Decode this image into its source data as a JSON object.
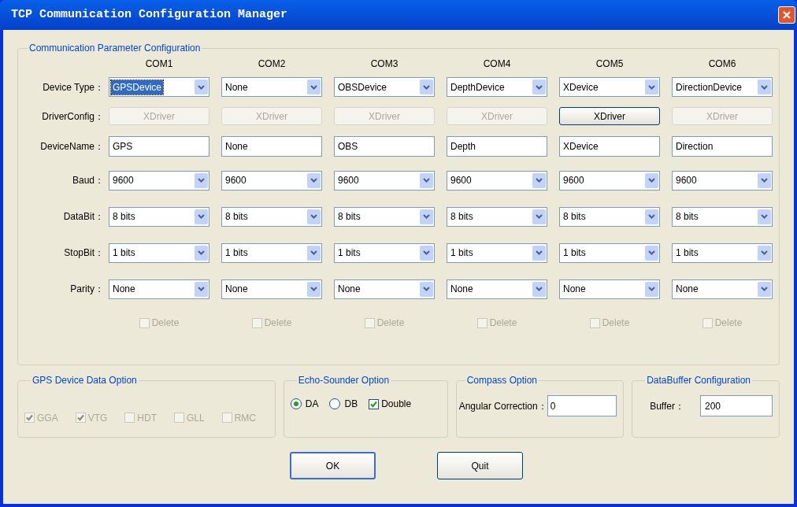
{
  "window": {
    "title": "TCP Communication Configuration Manager"
  },
  "config": {
    "legend": "Communication Parameter Configuration",
    "row_labels": [
      "Device Type：",
      "DriverConfig：",
      "DeviceName：",
      "Baud：",
      "DataBit：",
      "StopBit：",
      "Parity："
    ],
    "ports": [
      {
        "name": "COM1",
        "device_type": {
          "value": "GPSDevice",
          "focused": true
        },
        "driver": {
          "label": "XDriver",
          "disabled": true
        },
        "device_name": "GPS",
        "baud": "9600",
        "data_bit": "8 bits",
        "stop_bit": "1 bits",
        "parity": "None",
        "delete": {
          "label": "Delete",
          "checked": false,
          "disabled": true
        }
      },
      {
        "name": "COM2",
        "device_type": {
          "value": "None",
          "focused": false
        },
        "driver": {
          "label": "XDriver",
          "disabled": true
        },
        "device_name": "None",
        "baud": "9600",
        "data_bit": "8 bits",
        "stop_bit": "1 bits",
        "parity": "None",
        "delete": {
          "label": "Delete",
          "checked": false,
          "disabled": true
        }
      },
      {
        "name": "COM3",
        "device_type": {
          "value": "OBSDevice",
          "focused": false
        },
        "driver": {
          "label": "XDriver",
          "disabled": true
        },
        "device_name": "OBS",
        "baud": "9600",
        "data_bit": "8 bits",
        "stop_bit": "1 bits",
        "parity": "None",
        "delete": {
          "label": "Delete",
          "checked": false,
          "disabled": true
        }
      },
      {
        "name": "COM4",
        "device_type": {
          "value": "DepthDevice",
          "focused": false
        },
        "driver": {
          "label": "XDriver",
          "disabled": true
        },
        "device_name": "Depth",
        "baud": "9600",
        "data_bit": "8 bits",
        "stop_bit": "1 bits",
        "parity": "None",
        "delete": {
          "label": "Delete",
          "checked": false,
          "disabled": true
        }
      },
      {
        "name": "COM5",
        "device_type": {
          "value": "XDevice",
          "focused": false
        },
        "driver": {
          "label": "XDriver",
          "disabled": false
        },
        "device_name": "XDevice",
        "baud": "9600",
        "data_bit": "8 bits",
        "stop_bit": "1 bits",
        "parity": "None",
        "delete": {
          "label": "Delete",
          "checked": false,
          "disabled": true
        }
      },
      {
        "name": "COM6",
        "device_type": {
          "value": "DirectionDevice",
          "focused": false
        },
        "driver": {
          "label": "XDriver",
          "disabled": true
        },
        "device_name": "Direction",
        "baud": "9600",
        "data_bit": "8 bits",
        "stop_bit": "1 bits",
        "parity": "None",
        "delete": {
          "label": "Delete",
          "checked": false,
          "disabled": true
        }
      }
    ]
  },
  "gps_option": {
    "legend": "GPS Device Data Option",
    "items": [
      {
        "label": "GGA",
        "checked": true,
        "disabled": true
      },
      {
        "label": "VTG",
        "checked": true,
        "disabled": true
      },
      {
        "label": "HDT",
        "checked": false,
        "disabled": true
      },
      {
        "label": "GLL",
        "checked": false,
        "disabled": true
      },
      {
        "label": "RMC",
        "checked": false,
        "disabled": true
      }
    ]
  },
  "echo_option": {
    "legend": "Echo-Sounder Option",
    "radios": [
      {
        "label": "DA",
        "selected": true
      },
      {
        "label": "DB",
        "selected": false
      }
    ],
    "double": {
      "label": "Double",
      "checked": true
    }
  },
  "compass_option": {
    "legend": "Compass Option",
    "label": "Angular Correction：",
    "value": "0"
  },
  "buffer_option": {
    "legend": "DataBuffer Configuration",
    "label": "Buffer：",
    "value": "200"
  },
  "buttons": [
    {
      "label": "OK",
      "default": true
    },
    {
      "label": "Quit",
      "default": false
    }
  ]
}
